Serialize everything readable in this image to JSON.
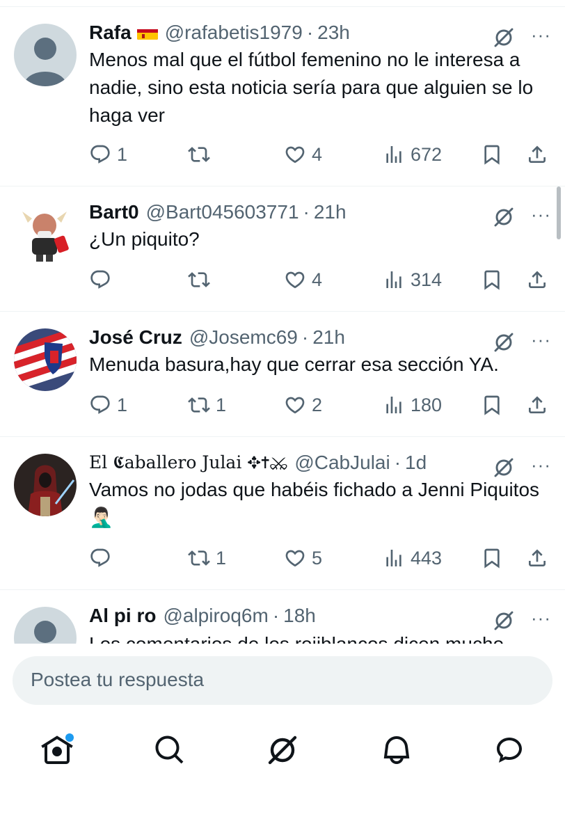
{
  "tweets": [
    {
      "name": "Rafa",
      "has_flag": true,
      "handle": "@rafabetis1979",
      "separator": "·",
      "time": "23h",
      "text": "Menos mal que el fútbol femenino no le interesa a nadie, sino esta noticia sería para que alguien se lo haga ver",
      "replies": "1",
      "reposts": "",
      "likes": "4",
      "views": "672",
      "avatar": "default-avatar"
    },
    {
      "name": "Bart0",
      "handle": "@Bart045603771",
      "separator": "·",
      "time": "21h",
      "text": "¿Un piquito?",
      "replies": "",
      "reposts": "",
      "likes": "4",
      "views": "314",
      "avatar": "cartoon-avatar"
    },
    {
      "name": "José Cruz",
      "handle": "@Josemc69",
      "separator": "·",
      "time": "21h",
      "text": "Menuda basura,hay que cerrar esa sección YA.",
      "replies": "1",
      "reposts": "1",
      "likes": "2",
      "views": "180",
      "avatar": "flag-avatar"
    },
    {
      "name": "El 𝕮aballero Julai ✥✝⚔",
      "fancy": true,
      "handle": "@CabJulai",
      "separator": "·",
      "time": "1d",
      "text": "Vamos no jodas que habéis fichado a Jenni Piquitos 🤦🏻‍♂️",
      "replies": "",
      "reposts": "1",
      "likes": "5",
      "views": "443",
      "avatar": "warrior-avatar"
    },
    {
      "name": "Al pi ro",
      "handle": "@alpiroq6m",
      "separator": "·",
      "time": "18h",
      "text": "Los comentarios de los rojiblancos dicen mucho",
      "avatar": "default-avatar"
    }
  ],
  "more_label": "···",
  "reply": {
    "placeholder": "Postea tu respuesta"
  },
  "nav": {
    "items": [
      "home-icon",
      "search-icon",
      "grok-icon",
      "notifications-icon",
      "messages-icon"
    ],
    "home_has_badge": true
  },
  "colors": {
    "text": "#0f1419",
    "secondary": "#536471",
    "accent": "#1d9bf0",
    "divider": "#eff3f4"
  }
}
